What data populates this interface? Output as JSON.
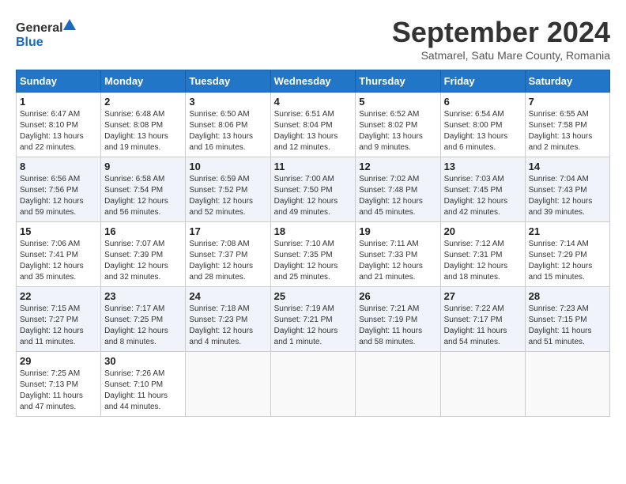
{
  "header": {
    "logo_line1": "General",
    "logo_line2": "Blue",
    "month": "September 2024",
    "location": "Satmarel, Satu Mare County, Romania"
  },
  "weekdays": [
    "Sunday",
    "Monday",
    "Tuesday",
    "Wednesday",
    "Thursday",
    "Friday",
    "Saturday"
  ],
  "weeks": [
    [
      {
        "num": "1",
        "sunrise": "6:47 AM",
        "sunset": "8:10 PM",
        "daylight": "13 hours and 22 minutes."
      },
      {
        "num": "2",
        "sunrise": "6:48 AM",
        "sunset": "8:08 PM",
        "daylight": "13 hours and 19 minutes."
      },
      {
        "num": "3",
        "sunrise": "6:50 AM",
        "sunset": "8:06 PM",
        "daylight": "13 hours and 16 minutes."
      },
      {
        "num": "4",
        "sunrise": "6:51 AM",
        "sunset": "8:04 PM",
        "daylight": "13 hours and 12 minutes."
      },
      {
        "num": "5",
        "sunrise": "6:52 AM",
        "sunset": "8:02 PM",
        "daylight": "13 hours and 9 minutes."
      },
      {
        "num": "6",
        "sunrise": "6:54 AM",
        "sunset": "8:00 PM",
        "daylight": "13 hours and 6 minutes."
      },
      {
        "num": "7",
        "sunrise": "6:55 AM",
        "sunset": "7:58 PM",
        "daylight": "13 hours and 2 minutes."
      }
    ],
    [
      {
        "num": "8",
        "sunrise": "6:56 AM",
        "sunset": "7:56 PM",
        "daylight": "12 hours and 59 minutes."
      },
      {
        "num": "9",
        "sunrise": "6:58 AM",
        "sunset": "7:54 PM",
        "daylight": "12 hours and 56 minutes."
      },
      {
        "num": "10",
        "sunrise": "6:59 AM",
        "sunset": "7:52 PM",
        "daylight": "12 hours and 52 minutes."
      },
      {
        "num": "11",
        "sunrise": "7:00 AM",
        "sunset": "7:50 PM",
        "daylight": "12 hours and 49 minutes."
      },
      {
        "num": "12",
        "sunrise": "7:02 AM",
        "sunset": "7:48 PM",
        "daylight": "12 hours and 45 minutes."
      },
      {
        "num": "13",
        "sunrise": "7:03 AM",
        "sunset": "7:45 PM",
        "daylight": "12 hours and 42 minutes."
      },
      {
        "num": "14",
        "sunrise": "7:04 AM",
        "sunset": "7:43 PM",
        "daylight": "12 hours and 39 minutes."
      }
    ],
    [
      {
        "num": "15",
        "sunrise": "7:06 AM",
        "sunset": "7:41 PM",
        "daylight": "12 hours and 35 minutes."
      },
      {
        "num": "16",
        "sunrise": "7:07 AM",
        "sunset": "7:39 PM",
        "daylight": "12 hours and 32 minutes."
      },
      {
        "num": "17",
        "sunrise": "7:08 AM",
        "sunset": "7:37 PM",
        "daylight": "12 hours and 28 minutes."
      },
      {
        "num": "18",
        "sunrise": "7:10 AM",
        "sunset": "7:35 PM",
        "daylight": "12 hours and 25 minutes."
      },
      {
        "num": "19",
        "sunrise": "7:11 AM",
        "sunset": "7:33 PM",
        "daylight": "12 hours and 21 minutes."
      },
      {
        "num": "20",
        "sunrise": "7:12 AM",
        "sunset": "7:31 PM",
        "daylight": "12 hours and 18 minutes."
      },
      {
        "num": "21",
        "sunrise": "7:14 AM",
        "sunset": "7:29 PM",
        "daylight": "12 hours and 15 minutes."
      }
    ],
    [
      {
        "num": "22",
        "sunrise": "7:15 AM",
        "sunset": "7:27 PM",
        "daylight": "12 hours and 11 minutes."
      },
      {
        "num": "23",
        "sunrise": "7:17 AM",
        "sunset": "7:25 PM",
        "daylight": "12 hours and 8 minutes."
      },
      {
        "num": "24",
        "sunrise": "7:18 AM",
        "sunset": "7:23 PM",
        "daylight": "12 hours and 4 minutes."
      },
      {
        "num": "25",
        "sunrise": "7:19 AM",
        "sunset": "7:21 PM",
        "daylight": "12 hours and 1 minute."
      },
      {
        "num": "26",
        "sunrise": "7:21 AM",
        "sunset": "7:19 PM",
        "daylight": "11 hours and 58 minutes."
      },
      {
        "num": "27",
        "sunrise": "7:22 AM",
        "sunset": "7:17 PM",
        "daylight": "11 hours and 54 minutes."
      },
      {
        "num": "28",
        "sunrise": "7:23 AM",
        "sunset": "7:15 PM",
        "daylight": "11 hours and 51 minutes."
      }
    ],
    [
      {
        "num": "29",
        "sunrise": "7:25 AM",
        "sunset": "7:13 PM",
        "daylight": "11 hours and 47 minutes."
      },
      {
        "num": "30",
        "sunrise": "7:26 AM",
        "sunset": "7:10 PM",
        "daylight": "11 hours and 44 minutes."
      },
      null,
      null,
      null,
      null,
      null
    ]
  ]
}
